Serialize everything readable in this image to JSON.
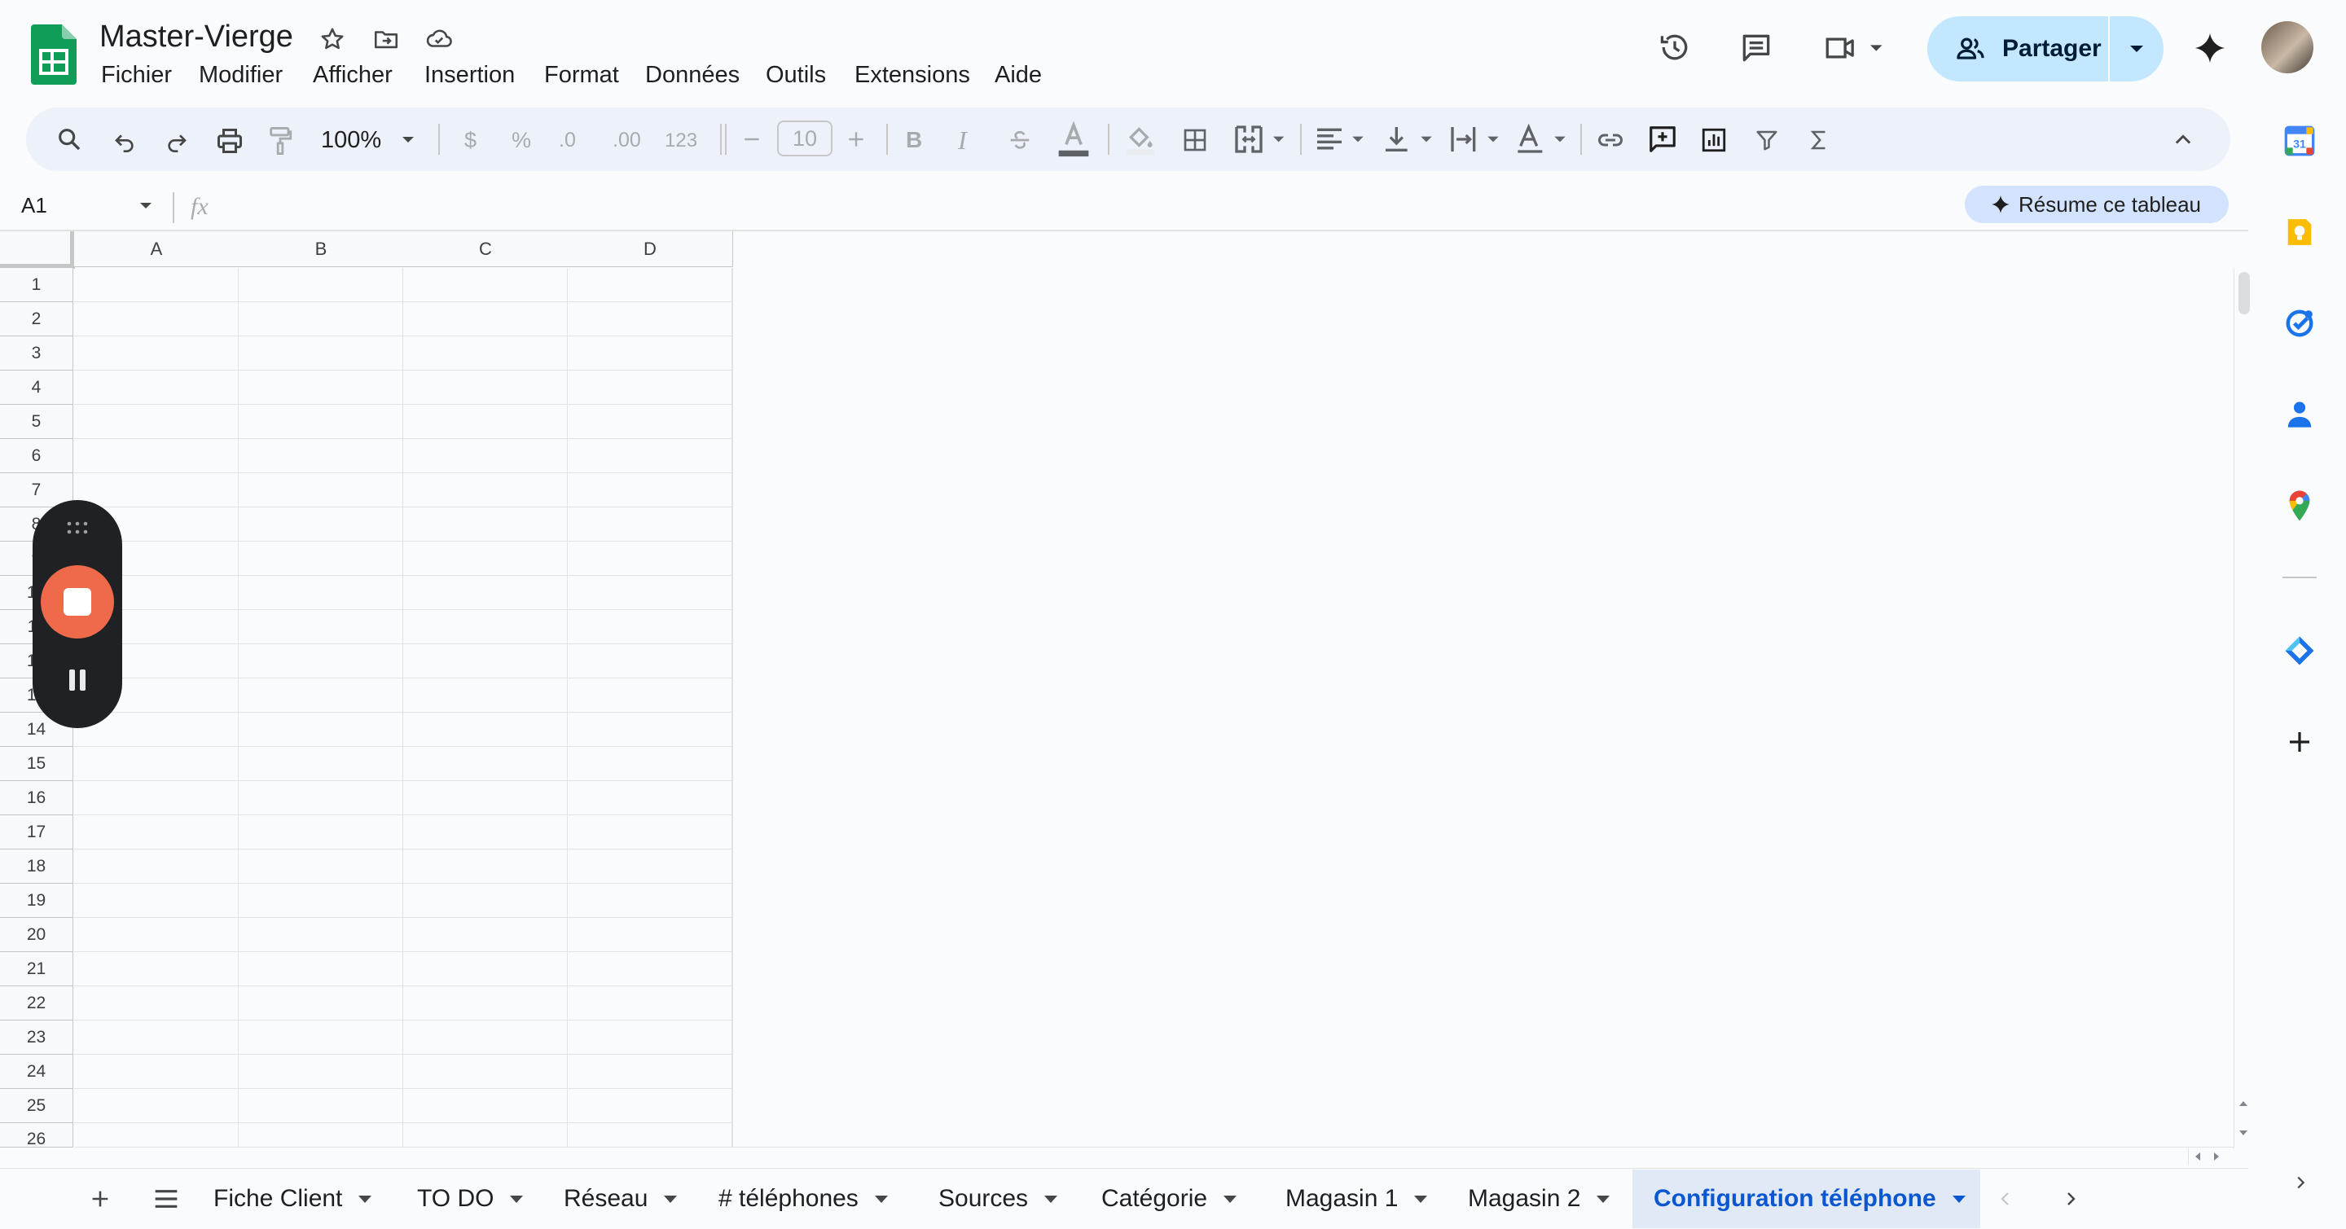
{
  "header": {
    "title": "Master-Vierge",
    "menu": [
      "Fichier",
      "Modifier",
      "Afficher",
      "Insertion",
      "Format",
      "Données",
      "Outils",
      "Extensions",
      "Aide"
    ],
    "share_label": "Partager"
  },
  "toolbar": {
    "zoom": "100%",
    "currency": "$",
    "percent": "%",
    "decrease_decimal": ".0",
    "increase_decimal": ".00",
    "number_format": "123",
    "font_size": "10",
    "bold": "B",
    "italic": "I"
  },
  "formula_bar": {
    "name_box": "A1",
    "fx": "fx",
    "summarize_label": "Résume ce tableau"
  },
  "grid": {
    "columns": [
      "A",
      "B",
      "C",
      "D"
    ],
    "rows": [
      "1",
      "2",
      "3",
      "4",
      "5",
      "6",
      "7",
      "8",
      "9",
      "10",
      "11",
      "12",
      "13",
      "14",
      "15",
      "16",
      "17",
      "18",
      "19",
      "20",
      "21",
      "22",
      "23",
      "24",
      "25",
      "26"
    ]
  },
  "sheets": {
    "tabs": [
      "Fiche Client",
      "TO DO",
      "Réseau",
      "# téléphones",
      "Sources",
      "Catégorie",
      "Magasin 1",
      "Magasin 2"
    ],
    "active": "Configuration téléphone"
  },
  "side_panel": {
    "calendar_day": "31",
    "icons": [
      "calendar-icon",
      "keep-icon",
      "tasks-icon",
      "contacts-icon",
      "maps-icon",
      "addon-icon",
      "add-icon"
    ]
  },
  "colors": {
    "share_bg": "#c2e7ff",
    "toolbar_bg": "#edf2fa",
    "active_tab": "#0b57d0",
    "recorder_stop": "#ee6a4b",
    "sheets_green": "#0f9d58"
  }
}
